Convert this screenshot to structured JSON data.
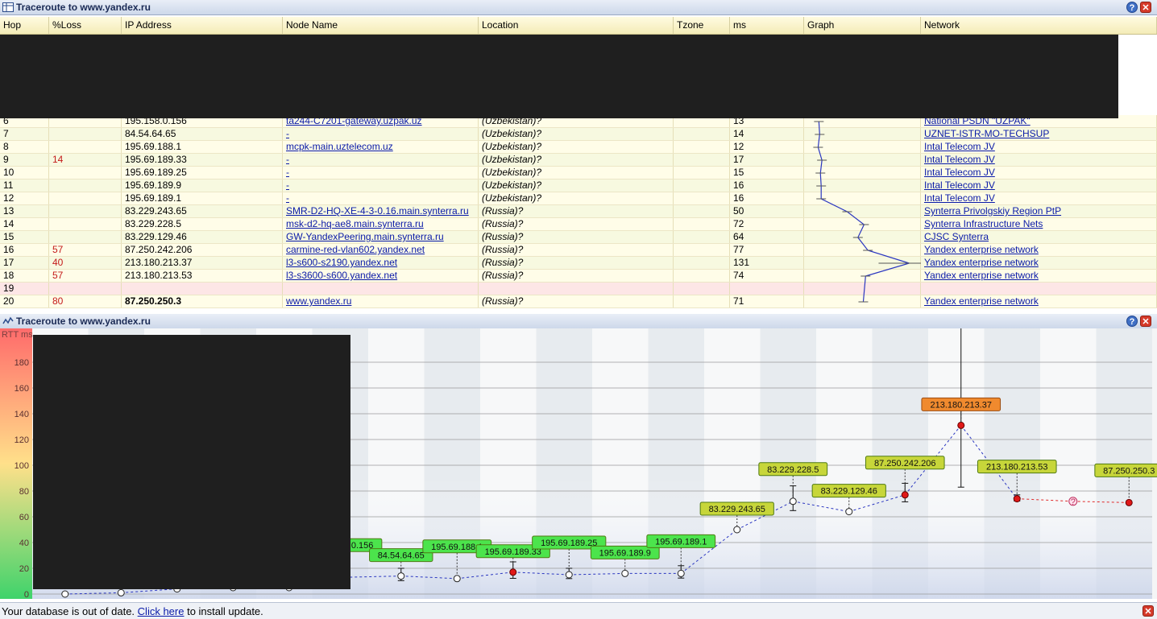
{
  "top_window": {
    "title": "Traceroute to www.yandex.ru",
    "help_icon": "help-icon",
    "close_icon": "close-icon"
  },
  "table": {
    "columns": [
      "Hop",
      "%Loss",
      "IP Address",
      "Node Name",
      "Location",
      "Tzone",
      "ms",
      "Graph",
      "Network"
    ],
    "rows": [
      {
        "hop": "6",
        "loss": "",
        "ip": "195.158.0.156",
        "name": "ta244-C7201-gateway.uzpak.uz",
        "loc": "(Uzbekistan)?",
        "tz": "",
        "ms": "13",
        "net": "National PSDN \"UZPAK\""
      },
      {
        "hop": "7",
        "loss": "",
        "ip": "84.54.64.65",
        "name": "-",
        "loc": "(Uzbekistan)?",
        "tz": "",
        "ms": "14",
        "net": "UZNET-ISTR-MO-TECHSUP"
      },
      {
        "hop": "8",
        "loss": "",
        "ip": "195.69.188.1",
        "name": "mcpk-main.uztelecom.uz",
        "loc": "(Uzbekistan)?",
        "tz": "",
        "ms": "12",
        "net": "Intal Telecom JV"
      },
      {
        "hop": "9",
        "loss": "14",
        "ip": "195.69.189.33",
        "name": "-",
        "loc": "(Uzbekistan)?",
        "tz": "",
        "ms": "17",
        "net": "Intal Telecom JV"
      },
      {
        "hop": "10",
        "loss": "",
        "ip": "195.69.189.25",
        "name": "-",
        "loc": "(Uzbekistan)?",
        "tz": "",
        "ms": "15",
        "net": "Intal Telecom JV"
      },
      {
        "hop": "11",
        "loss": "",
        "ip": "195.69.189.9",
        "name": "-",
        "loc": "(Uzbekistan)?",
        "tz": "",
        "ms": "16",
        "net": "Intal Telecom JV"
      },
      {
        "hop": "12",
        "loss": "",
        "ip": "195.69.189.1",
        "name": "-",
        "loc": "(Uzbekistan)?",
        "tz": "",
        "ms": "16",
        "net": "Intal Telecom JV"
      },
      {
        "hop": "13",
        "loss": "",
        "ip": "83.229.243.65",
        "name": "SMR-D2-HQ-XE-4-3-0.16.main.synterra.ru",
        "loc": "(Russia)?",
        "tz": "",
        "ms": "50",
        "net": "Synterra Privolgskiy Region PtP"
      },
      {
        "hop": "14",
        "loss": "",
        "ip": "83.229.228.5",
        "name": "msk-d2-hq-ae8.main.synterra.ru",
        "loc": "(Russia)?",
        "tz": "",
        "ms": "72",
        "net": "Synterra Infrastructure Nets"
      },
      {
        "hop": "15",
        "loss": "",
        "ip": "83.229.129.46",
        "name": "GW-YandexPeering.main.synterra.ru",
        "loc": "(Russia)?",
        "tz": "",
        "ms": "64",
        "net": "CJSC Synterra"
      },
      {
        "hop": "16",
        "loss": "57",
        "ip": "87.250.242.206",
        "name": "carmine-red-vlan602.yandex.net",
        "loc": "(Russia)?",
        "tz": "",
        "ms": "77",
        "net": "Yandex enterprise network"
      },
      {
        "hop": "17",
        "loss": "40",
        "ip": "213.180.213.37",
        "name": "l3-s600-s2190.yandex.net",
        "loc": "(Russia)?",
        "tz": "",
        "ms": "131",
        "net": "Yandex enterprise network"
      },
      {
        "hop": "18",
        "loss": "57",
        "ip": "213.180.213.53",
        "name": "l3-s3600-s600.yandex.net",
        "loc": "(Russia)?",
        "tz": "",
        "ms": "74",
        "net": "Yandex enterprise network"
      },
      {
        "hop": "19",
        "loss": "",
        "ip": "",
        "name": "",
        "loc": "",
        "tz": "",
        "ms": "",
        "net": ""
      },
      {
        "hop": "20",
        "loss": "80",
        "ip": "87.250.250.3",
        "name": "www.yandex.ru",
        "loc": "(Russia)?",
        "tz": "",
        "ms": "71",
        "net": "Yandex enterprise network"
      }
    ]
  },
  "bottom_window": {
    "title": "Traceroute to www.yandex.ru"
  },
  "chart_data": {
    "type": "line",
    "ylabel": "RTT ms",
    "ylim": [
      0,
      200
    ],
    "yticks": [
      0,
      20,
      40,
      60,
      80,
      100,
      120,
      140,
      160,
      180
    ],
    "points": [
      {
        "hop": 1,
        "ms": 0
      },
      {
        "hop": 2,
        "ms": 1
      },
      {
        "hop": 3,
        "ms": 4
      },
      {
        "hop": 4,
        "ms": 5
      },
      {
        "hop": 5,
        "ms": 5
      },
      {
        "hop": 6,
        "ms": 13,
        "label": "195.158.0.156"
      },
      {
        "hop": 7,
        "ms": 14,
        "label": "84.54.64.65"
      },
      {
        "hop": 8,
        "ms": 12,
        "label": "195.69.188.1"
      },
      {
        "hop": 9,
        "ms": 17,
        "label": "195.69.189.33",
        "loss": true
      },
      {
        "hop": 10,
        "ms": 15,
        "label": "195.69.189.25"
      },
      {
        "hop": 11,
        "ms": 16,
        "label": "195.69.189.9"
      },
      {
        "hop": 12,
        "ms": 16,
        "label": "195.69.189.1"
      },
      {
        "hop": 13,
        "ms": 50,
        "label": "83.229.243.65"
      },
      {
        "hop": 14,
        "ms": 72,
        "label": "83.229.228.5"
      },
      {
        "hop": 15,
        "ms": 64,
        "label": "83.229.129.46"
      },
      {
        "hop": 16,
        "ms": 77,
        "label": "87.250.242.206",
        "loss": true
      },
      {
        "hop": 17,
        "ms": 131,
        "label": "213.180.213.37",
        "loss": true
      },
      {
        "hop": 18,
        "ms": 74,
        "label": "213.180.213.53",
        "loss": true
      },
      {
        "hop": 19,
        "ms": 72,
        "unknown": true
      },
      {
        "hop": 20,
        "ms": 71,
        "label": "87.250.250.3",
        "loss": true
      }
    ]
  },
  "status": {
    "text_before": "Your database is out of date.",
    "link": "Click here",
    "text_after": "to install update."
  }
}
